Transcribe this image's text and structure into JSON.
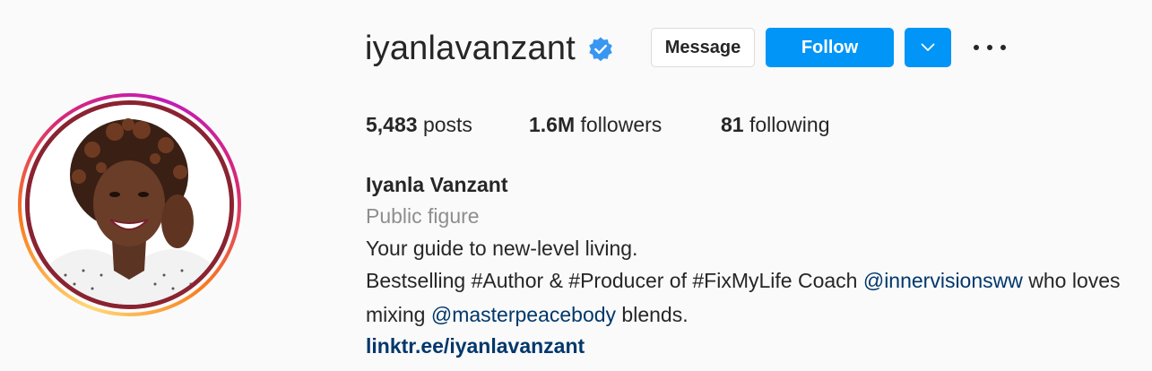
{
  "profile": {
    "username": "iyanlavanzant",
    "verified": true,
    "full_name": "Iyanla Vanzant",
    "category": "Public figure",
    "bio_line1": "Your guide to new-level living.",
    "bio_line2_pre": "Bestselling #Author & #Producer of #FixMyLife Coach ",
    "bio_line2_mention": "@innervisionsww",
    "bio_line2_post": " who loves",
    "bio_line3_pre": "mixing ",
    "bio_line3_mention": "@masterpeacebody",
    "bio_line3_post": " blends.",
    "link": "linktr.ee/iyanlavanzant"
  },
  "stats": {
    "posts_count": "5,483",
    "posts_label": "posts",
    "followers_count": "1.6M",
    "followers_label": "followers",
    "following_count": "81",
    "following_label": "following"
  },
  "actions": {
    "message_label": "Message",
    "follow_label": "Follow"
  },
  "icons": {
    "verified": "verified-badge-icon",
    "dropdown": "chevron-down-icon",
    "more": "more-options-icon"
  },
  "colors": {
    "accent": "#0095f6",
    "verified": "#3897f0",
    "link": "#00376b",
    "muted": "#8e8e8e",
    "text": "#262626",
    "background": "#fafafa"
  }
}
